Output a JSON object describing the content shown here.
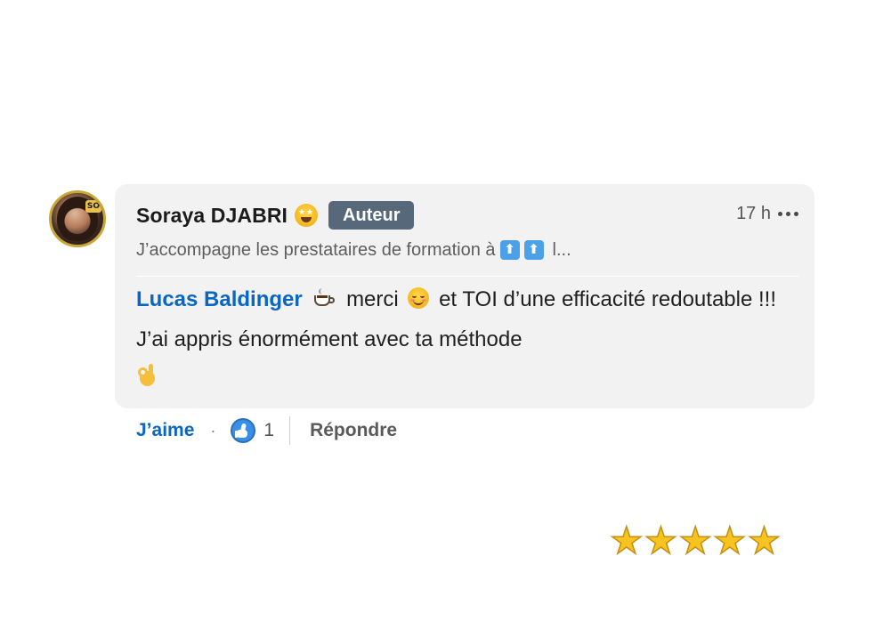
{
  "comment": {
    "author": {
      "name": "Soraya DJABRI",
      "name_emoji": "star-struck-face-icon",
      "badge": "Auteur",
      "avatar_badge_text": "SO"
    },
    "timestamp": "17 h",
    "headline": {
      "text": "J’accompagne les prestataires de formation à",
      "arrow_glyph_1": "⬆",
      "arrow_glyph_2": "⬆",
      "truncation": "l..."
    },
    "body": {
      "mention": "Lucas Baldinger",
      "part_1": "merci",
      "part_2": "et TOI d’une efficacité redoutable !!! J’ai appris énormément avec ta méthode"
    },
    "emojis": [
      "coffee-icon",
      "smiling-face-icon",
      "ok-hand-icon"
    ]
  },
  "actions": {
    "like_label": "J’aime",
    "separator": "·",
    "reaction_count": "1",
    "reply_label": "Répondre"
  },
  "rating": {
    "stars": 5,
    "max": 5,
    "glyph": "★"
  },
  "colors": {
    "bubble_bg": "#f2f2f2",
    "mention": "#0a66c2",
    "badge_bg": "#56687a",
    "star": "#f7c321",
    "avatar_ring": "#c9a635"
  }
}
